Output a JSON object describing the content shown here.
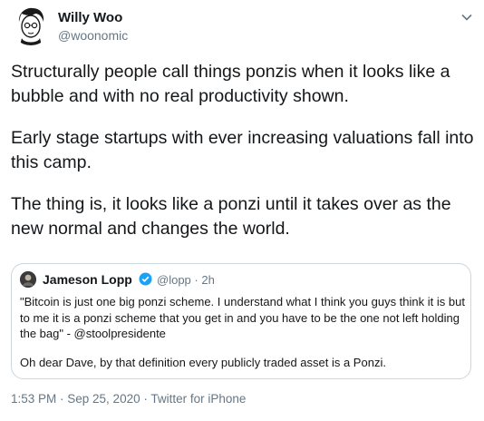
{
  "author": {
    "name": "Willy Woo",
    "handle": "@woonomic",
    "avatar_icon": "cartoon-portrait-icon"
  },
  "tweet": {
    "paragraphs": [
      "Structurally people call things ponzis when it looks like a bubble and with no real productivity shown.",
      "Early stage startups with ever increasing valuations fall into this camp.",
      "The thing is, it looks like a ponzi until it takes over as the new normal and changes the world."
    ]
  },
  "quoted": {
    "name": "Jameson Lopp",
    "handle": "@lopp",
    "separator": "·",
    "time": "2h",
    "paragraphs": [
      "\"Bitcoin is just one big ponzi scheme. I understand what I think you guys think it is but to me it is a ponzi scheme that you get in and you have to be the one not left holding the bag\" - @stoolpresidente",
      "Oh dear Dave, by that definition every publicly traded asset is a Ponzi."
    ]
  },
  "footer": {
    "timestamp": "1:53 PM · Sep 25, 2020 · Twitter for iPhone"
  },
  "colors": {
    "text": "#14171a",
    "secondary": "#657786",
    "border": "#ccd6dd",
    "verified": "#1da1f2"
  }
}
